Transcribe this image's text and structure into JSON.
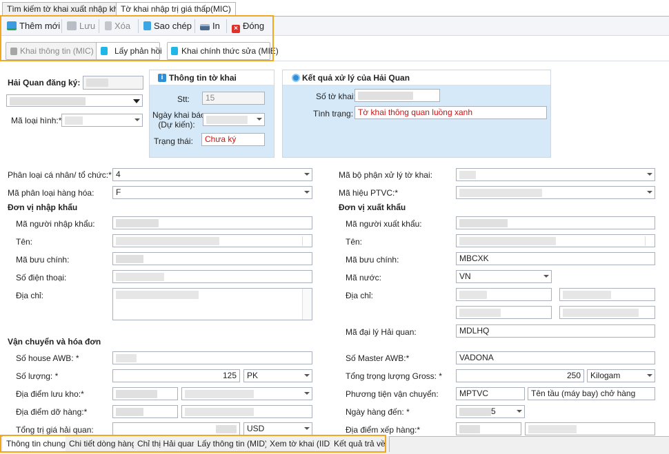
{
  "tabs": [
    {
      "label": "Tìm kiếm tờ khai xuất nhập khẩu"
    },
    {
      "label": "Tờ khai nhập trị giá thấp(MIC)"
    }
  ],
  "toolbar": {
    "add": "Thêm mới",
    "save": "Lưu",
    "delete": "Xóa",
    "copy": "Sao chép",
    "print": "In",
    "close": "Đóng"
  },
  "actions": {
    "declare_info": "Khai thông tin (MIC)",
    "get_feedback": "Lấy phản hồi",
    "official_edit": "Khai chính thức sửa (MIE)"
  },
  "customs": {
    "label": "Hải Quan đăng ký:",
    "type_label": "Mã loại hình:*"
  },
  "decl_info": {
    "title": "Thông tin tờ khai",
    "stt_label": "Stt:",
    "stt_value": "15",
    "date_label_1": "Ngày khai báo",
    "date_label_2": "(Dự kiến):",
    "status_label": "Trạng thái:",
    "status_value": "Chưa ký"
  },
  "result": {
    "title": "Kết quả xử lý của Hải Quan",
    "number_label": "Số tờ khai:",
    "state_label": "Tình trạng:",
    "state_value": "Tờ khai thông quan luồng xanh"
  },
  "left": {
    "person_type_label": "Phân loại cá nhân/ tổ chức:*",
    "person_type_value": "4",
    "goods_type_label": "Mã phân loại hàng hóa:",
    "goods_type_value": "F",
    "importer_title": "Đơn vị nhập khẩu",
    "importer_code": "Mã người nhập khẩu:",
    "name": "Tên:",
    "postal": "Mã bưu chính:",
    "phone": "Số điện thoại:",
    "address": "Địa chỉ:",
    "transport_title": "Vận chuyển và hóa đơn",
    "house_awb": "Số house AWB: *",
    "quantity_label": "Số lượng: *",
    "quantity_value": "125",
    "quantity_unit": "PK",
    "storage_label": "Địa điểm lưu kho:*",
    "unload_label": "Địa điểm dỡ hàng:*",
    "value_label": "Tổng trị giá hải quan:",
    "currency": "USD"
  },
  "right": {
    "dept_label": "Mã bộ phận xử lý tờ khai:",
    "ptvc_label": "Mã hiệu PTVC:*",
    "exporter_title": "Đơn vị xuất khẩu",
    "exporter_code": "Mã người xuất khẩu:",
    "name": "Tên:",
    "postal": "Mã bưu chính:",
    "postal_value": "MBCXK",
    "country_label": "Mã nước:",
    "country_value": "VN",
    "address": "Địa chỉ:",
    "agent_label": "Mã đại lý Hải quan:",
    "agent_value": "MDLHQ",
    "master_awb_label": "Số Master AWB:*",
    "master_awb_value": "VADONA",
    "gross_label": "Tổng trọng lượng Gross: *",
    "gross_value": "250",
    "gross_unit": "Kilogam",
    "vehicle_label": "Phương tiện vận chuyển:",
    "vehicle_code": "MPTVC",
    "vehicle_name": "Tên tầu (máy bay) chở hàng",
    "arrival_label": "Ngày hàng đến: *",
    "arrival_value": "5",
    "loading_label": "Địa điểm xếp hàng:*"
  },
  "bottom_tabs": [
    {
      "label": "Thông tin chung"
    },
    {
      "label": "Chi tiết dòng hàng"
    },
    {
      "label": "Chỉ thị Hải quan"
    },
    {
      "label": "Lấy thông tin (MID)"
    },
    {
      "label": "Xem tờ khai (IID)"
    },
    {
      "label": "Kết quả trả về"
    }
  ]
}
